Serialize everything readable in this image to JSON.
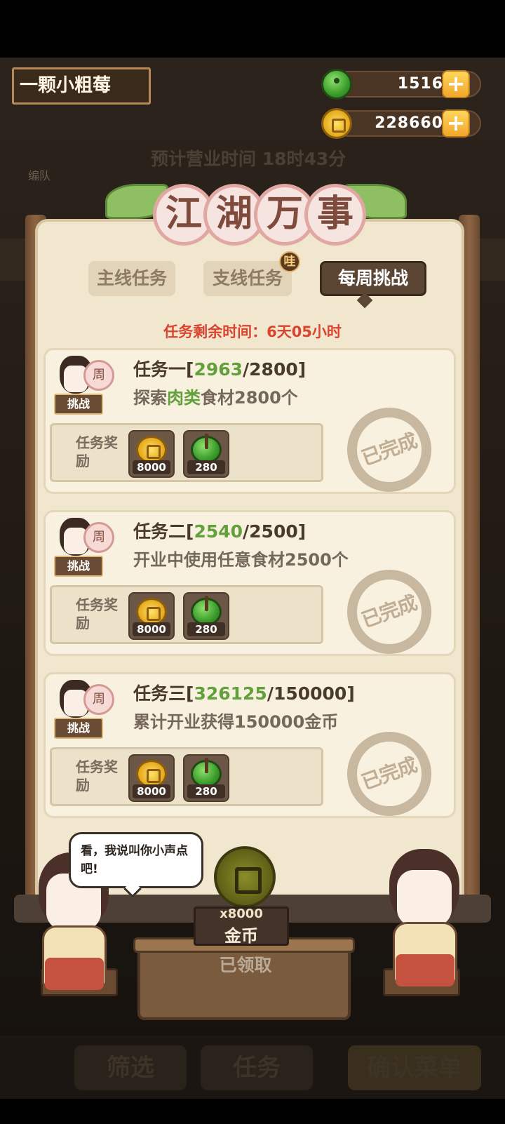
{
  "header": {
    "player_name": "一颗小粗莓",
    "gems": "1516",
    "coins": "228660",
    "plus": "+",
    "business_time": "预计营业时间  18时43分",
    "team_label": "编队"
  },
  "panel": {
    "title_chars": [
      "江",
      "湖",
      "万",
      "事"
    ],
    "tabs": [
      {
        "label": "主线任务",
        "active": false
      },
      {
        "label": "支线任务",
        "active": false,
        "badge": "哇"
      },
      {
        "label": "每周挑战",
        "active": true
      }
    ],
    "timer": "任务剩余时间：6天05小时"
  },
  "missions": [
    {
      "badge_disc": "周",
      "badge_label": "挑战",
      "title_prefix": "任务一[",
      "progress": "2963",
      "title_suffix": "/2800]",
      "desc_prefix": "探索",
      "desc_highlight": "肉类",
      "desc_suffix": "食材2800个",
      "reward_label": "任务奖励",
      "reward_coins": "8000",
      "reward_gems": "280",
      "status": "已完成"
    },
    {
      "badge_disc": "周",
      "badge_label": "挑战",
      "title_prefix": "任务二[",
      "progress": "2540",
      "title_suffix": "/2500]",
      "desc_prefix": "开业中使用任意食材2500个",
      "desc_highlight": "",
      "desc_suffix": "",
      "reward_label": "任务奖励",
      "reward_coins": "8000",
      "reward_gems": "280",
      "status": "已完成"
    },
    {
      "badge_disc": "周",
      "badge_label": "挑战",
      "title_prefix": "任务三[",
      "progress": "326125",
      "title_suffix": "/150000]",
      "desc_prefix": "累计开业获得150000金币",
      "desc_highlight": "",
      "desc_suffix": "",
      "reward_label": "任务奖励",
      "reward_coins": "8000",
      "reward_gems": "280",
      "status": "已完成"
    }
  ],
  "bottom_reward": {
    "count": "x8000",
    "name": "金币",
    "status": "已领取"
  },
  "speech": "看，我说叫你小声点吧!",
  "nav": {
    "filter": "筛选",
    "tasks": "任务",
    "confirm": "确认菜单"
  },
  "colors": {
    "progress_green": "#62a03c",
    "timer_red": "#d9442f",
    "active_tab": "#5b4533"
  }
}
